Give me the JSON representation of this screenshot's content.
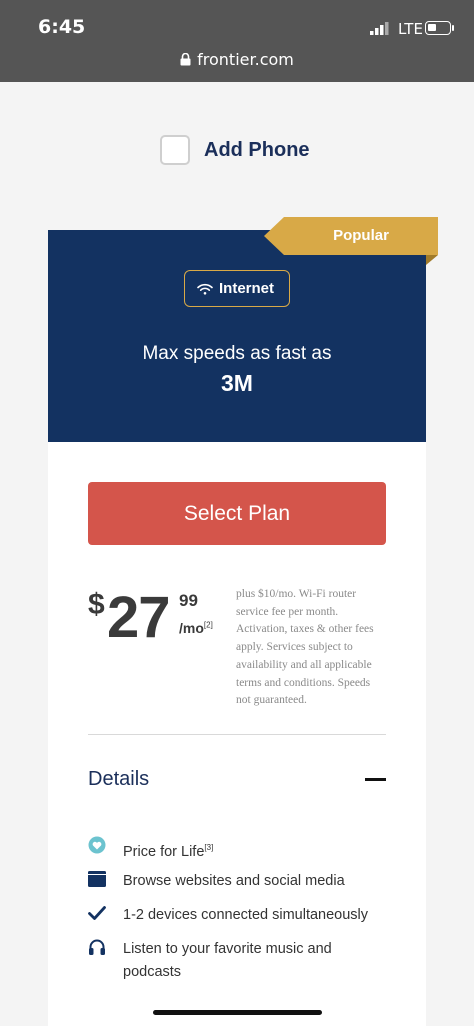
{
  "status_bar": {
    "time": "6:45",
    "network": "LTE",
    "battery_level": 0.3
  },
  "browser": {
    "url": "frontier.com"
  },
  "addon": {
    "label": "Add Phone",
    "checked": false
  },
  "plan": {
    "ribbon": "Popular",
    "tag": "Internet",
    "speed_prefix": "Max speeds as fast as",
    "speed_value": "3M",
    "select_label": "Select Plan",
    "price": {
      "currency": "$",
      "dollars": "27",
      "cents": "99",
      "period": "/mo",
      "footnote": "[2]"
    },
    "fine_print": "plus $10/mo. Wi-Fi router service fee per month. Activation, taxes & other fees apply. Services subject to availability and all applicable terms and conditions. Speeds not guaranteed."
  },
  "details": {
    "title": "Details",
    "features": [
      {
        "icon": "heart-icon",
        "text": "Price for Life",
        "footnote": "[3]"
      },
      {
        "icon": "browser-window-icon",
        "text": "Browse websites and social media"
      },
      {
        "icon": "checkmark-icon",
        "text": "1-2 devices connected simultaneously"
      },
      {
        "icon": "headphones-icon",
        "text": "Listen to your favorite music and podcasts"
      }
    ]
  },
  "colors": {
    "navy": "#133261",
    "gold": "#d8a947",
    "cta": "#d4554b",
    "teal": "#6cc3cf"
  }
}
